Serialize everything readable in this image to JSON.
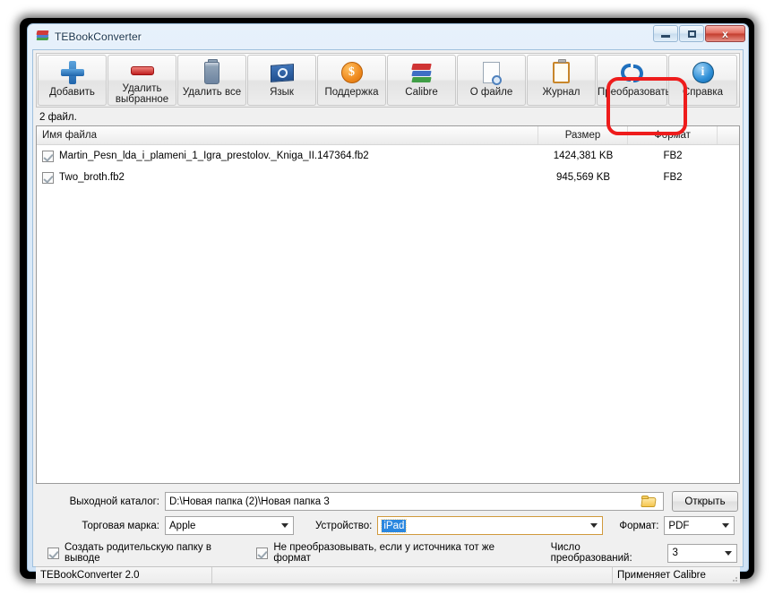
{
  "window": {
    "title": "TEBookConverter",
    "icon": "books-stack-icon",
    "controls": {
      "minimize": "minimize-button",
      "maximize": "maximize-button",
      "close": "close-button",
      "close_glyph": "x"
    }
  },
  "toolbar": {
    "buttons": [
      {
        "label": "Добавить",
        "icon": "plus-icon"
      },
      {
        "label": "Удалить\nвыбранное",
        "icon": "minus-icon"
      },
      {
        "label": "Удалить все",
        "icon": "trash-bin-icon"
      },
      {
        "label": "Язык",
        "icon": "un-flag-icon"
      },
      {
        "label": "Поддержка",
        "icon": "dollar-coin-icon",
        "glyph": "$"
      },
      {
        "label": "Calibre",
        "icon": "books-icon"
      },
      {
        "label": "О файле",
        "icon": "document-magnifier-icon"
      },
      {
        "label": "Журнал",
        "icon": "clipboard-icon"
      },
      {
        "label": "Преобразовать",
        "icon": "convert-arrows-icon",
        "highlighted": true
      },
      {
        "label": "Справка",
        "icon": "info-icon",
        "glyph": "i"
      }
    ],
    "highlight_color": "#ee1c1c"
  },
  "file_count_label": "2 файл.",
  "list": {
    "columns": [
      "Имя файла",
      "Размер",
      "Формат"
    ],
    "rows": [
      {
        "checked": true,
        "name": "Martin_Pesn_lda_i_plameni_1_Igra_prestolov._Kniga_II.147364.fb2",
        "size": "1424,381 KB",
        "format": "FB2"
      },
      {
        "checked": true,
        "name": "Two_broth.fb2",
        "size": "945,569 KB",
        "format": "FB2"
      }
    ]
  },
  "settings": {
    "output_dir_label": "Выходной каталог:",
    "output_dir_value": "D:\\Новая папка (2)\\Новая папка 3",
    "browse_icon": "folder-icon",
    "open_button": "Открыть",
    "brand_label": "Торговая марка:",
    "brand_value": "Apple",
    "device_label": "Устройство:",
    "device_value": "iPad",
    "device_selected": true,
    "format_label": "Формат:",
    "format_value": "PDF",
    "create_parent_folder": {
      "label": "Создать родительскую папку в выводе",
      "checked": true
    },
    "skip_same_format": {
      "label": "Не преобразовывать, если у источника тот же формат",
      "checked": true
    },
    "conversions_label": "Число преобразований:",
    "conversions_value": "3"
  },
  "status": {
    "left": "TEBookConverter 2.0",
    "middle": "",
    "right": "Применяет Calibre"
  }
}
